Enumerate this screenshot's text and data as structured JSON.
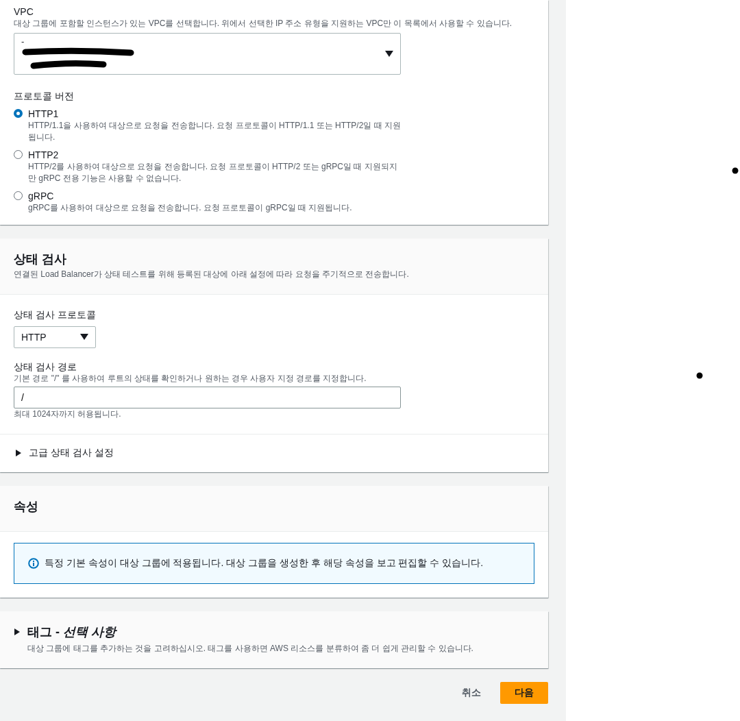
{
  "vpc": {
    "label": "VPC",
    "description": "대상 그룹에 포함할 인스턴스가 있는 VPC를 선택합니다. 위에서 선택한 IP 주소 유형을 지원하는 VPC만 이 목록에서 사용할 수 있습니다.",
    "value": "-"
  },
  "protocol_version": {
    "label": "프로토콜 버전",
    "options": [
      {
        "label": "HTTP1",
        "description": "HTTP/1.1을 사용하여 대상으로 요청을 전송합니다. 요청 프로토콜이 HTTP/1.1 또는 HTTP/2일 때 지원됩니다.",
        "selected": true
      },
      {
        "label": "HTTP2",
        "description": "HTTP/2를 사용하여 대상으로 요청을 전송합니다. 요청 프로토콜이 HTTP/2 또는 gRPC일 때 지원되지만 gRPC 전용 기능은 사용할 수 없습니다.",
        "selected": false
      },
      {
        "label": "gRPC",
        "description": "gRPC를 사용하여 대상으로 요청을 전송합니다. 요청 프로토콜이 gRPC일 때 지원됩니다.",
        "selected": false
      }
    ]
  },
  "health_check": {
    "title": "상태 검사",
    "description": "연결된 Load Balancer가 상태 테스트를 위해 등록된 대상에 아래 설정에 따라 요청을 주기적으로 전송합니다.",
    "protocol": {
      "label": "상태 검사 프로토콜",
      "value": "HTTP"
    },
    "path": {
      "label": "상태 검사 경로",
      "description": "기본 경로 \"/\" 를 사용하여 루트의 상태를 확인하거나 원하는 경우 사용자 지정 경로를 지정합니다.",
      "value": "/",
      "hint": "최대 1024자까지 허용됩니다."
    },
    "advanced": {
      "label": "고급 상태 검사 설정",
      "expanded": false
    }
  },
  "attributes": {
    "title": "속성",
    "info": "특정 기본 속성이 대상 그룹에 적용됩니다. 대상 그룹을 생성한 후 해당 속성을 보고 편집할 수 있습니다."
  },
  "tags": {
    "title": "태그 - *선택 사항*",
    "description": "대상 그룹에 태그를 추가하는 것을 고려하십시오. 태그를 사용하면 AWS 리소스를 분류하여 좀 더 쉽게 관리할 수 있습니다.",
    "expanded": false
  },
  "footer": {
    "cancel": "취소",
    "next": "다음"
  }
}
